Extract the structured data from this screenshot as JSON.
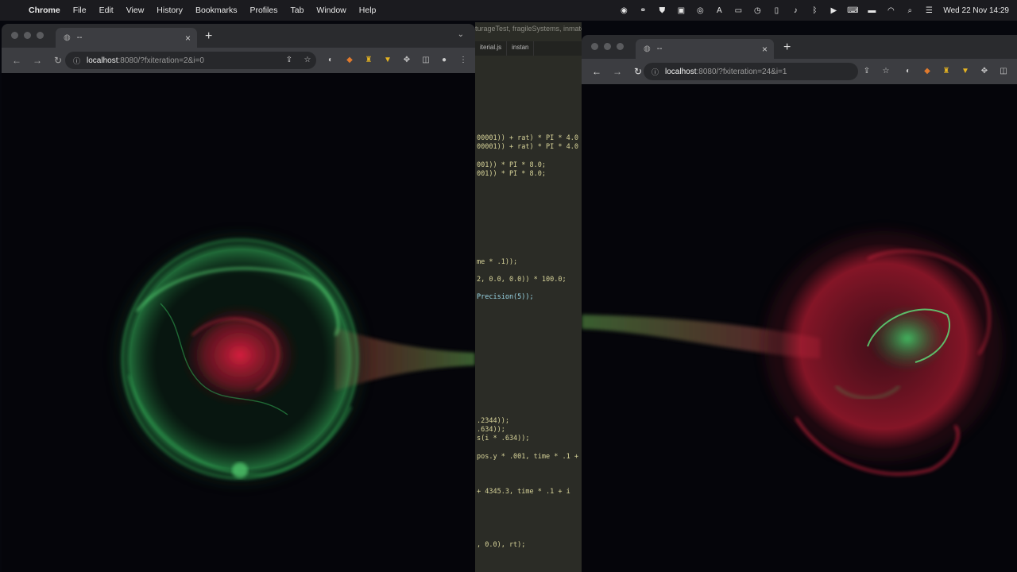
{
  "menubar": {
    "app": "Chrome",
    "menus": [
      "File",
      "Edit",
      "View",
      "History",
      "Bookmarks",
      "Profiles",
      "Tab",
      "Window",
      "Help"
    ],
    "clock": "Wed 22 Nov  14:29",
    "status_icons": [
      "eye-icon",
      "link-icon",
      "shield-icon",
      "box-icon",
      "record-icon",
      "a-icon",
      "display-icon",
      "clock-icon",
      "phone-icon",
      "volume-icon",
      "bluetooth-icon",
      "play-icon",
      "keyboard-icon",
      "battery-icon",
      "wifi-icon",
      "search-icon",
      "control-center-icon"
    ]
  },
  "editor": {
    "breadcrumb": "turageTest, fragileSystems, inmaterial, parentAndChild",
    "tabs": [
      "iterial.js",
      "instan"
    ],
    "code_lines": [
      "00001)) + rat) * PI * 4.0",
      "00001)) + rat) * PI * 4.0",
      "001)) * PI * 8.0;",
      "001)) * PI * 8.0;",
      "me * .1));",
      "2, 0.0, 0.0)) * 100.0;",
      "Precision(5));",
      ".2344));",
      ".634));",
      "s(i * .634));",
      "pos.y * .001, time * .1 +",
      "+ 4345.3, time * .1 + i",
      ", 0.0), rt);"
    ]
  },
  "left_window": {
    "tab_title": "--",
    "url_host": "localhost",
    "url_path": ":8080/?fxiteration=2&i=0"
  },
  "right_window": {
    "tab_title": "--",
    "url_host": "localhost",
    "url_path": ":8080/?fxiteration=24&i=1"
  },
  "colors": {
    "green": "#3fd46b",
    "red": "#d8203a",
    "background": "#05050a",
    "code": "#d8d49a"
  }
}
